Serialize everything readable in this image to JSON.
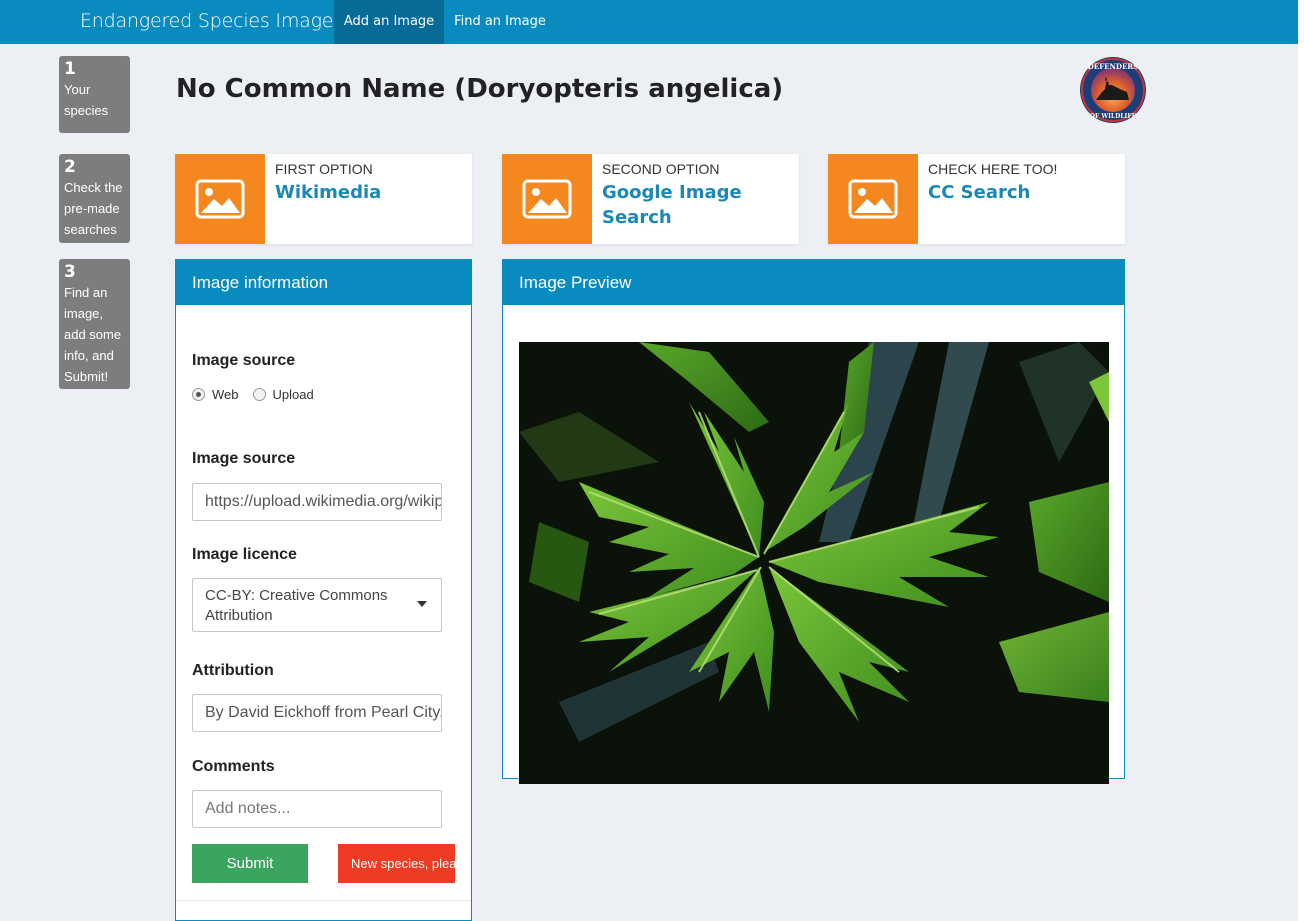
{
  "navbar": {
    "brand": "Endangered Species Images",
    "tabs": [
      {
        "label": "Add an Image",
        "active": true
      },
      {
        "label": "Find an Image",
        "active": false
      }
    ],
    "color": "#0a8bbf",
    "active_color": "#066b96"
  },
  "steps": [
    {
      "num": "1",
      "text": "Your species"
    },
    {
      "num": "2",
      "text": "Check the pre-made searches"
    },
    {
      "num": "3",
      "text": "Find an image, add some info, and Submit!"
    }
  ],
  "page_title": "No Common Name (Doryopteris angelica)",
  "logo": {
    "icon": "defenders-of-wildlife-logo",
    "text": "DEFENDERS OF WILDLIFE"
  },
  "search_cards": [
    {
      "kicker": "First option",
      "link": "Wikimedia",
      "icon": "image-icon"
    },
    {
      "kicker": "Second option",
      "link": "Google Image Search",
      "icon": "image-icon"
    },
    {
      "kicker": "Check here too!",
      "link": "CC Search",
      "icon": "image-icon"
    }
  ],
  "image_info": {
    "title": "Image information",
    "source_label": "Image source",
    "radio_web": "Web",
    "radio_upload": "Upload",
    "selected_source": "Web",
    "url_label": "Image source",
    "url_value": "https://upload.wikimedia.org/wikipedia/commons/",
    "licence_label": "Image licence",
    "licence_value": "CC-BY: Creative Commons Attribution",
    "attribution_label": "Attribution",
    "attribution_value": "By David Eickhoff from Pearl City, Hawaii",
    "comments_label": "Comments",
    "comments_placeholder": "Add notes...",
    "submit_label": "Submit",
    "new_species_label": "New species, please"
  },
  "image_preview": {
    "title": "Image Preview"
  },
  "colors": {
    "accent": "#0a8bbf",
    "orange": "#f5871f",
    "submit": "#3ba45e",
    "danger": "#ef3b24",
    "step_bg": "#7d7d7d",
    "link": "#1a87b9"
  }
}
